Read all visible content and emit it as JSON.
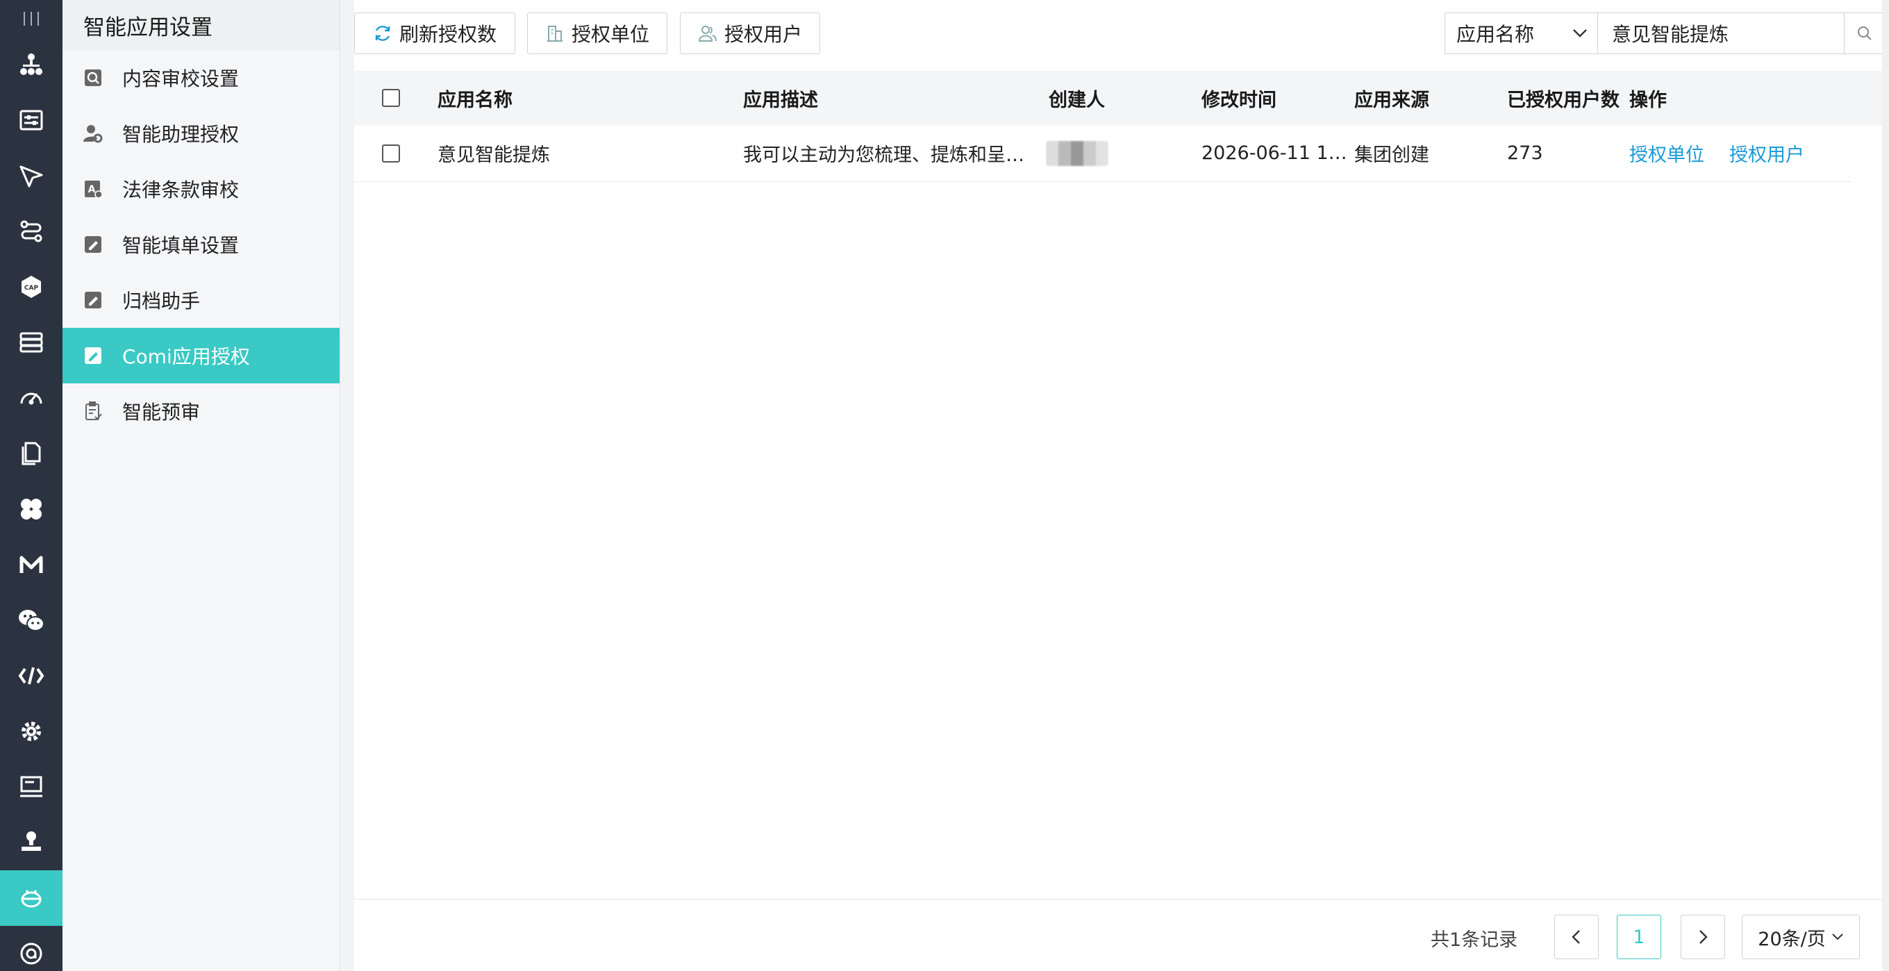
{
  "sidebar": {
    "title": "智能应用设置",
    "items": [
      {
        "label": "内容审校设置",
        "icon": "magnify-doc-icon"
      },
      {
        "label": "智能助理授权",
        "icon": "user-gear-icon"
      },
      {
        "label": "法律条款审校",
        "icon": "law-doc-icon"
      },
      {
        "label": "智能填单设置",
        "icon": "edit-form-icon"
      },
      {
        "label": "归档助手",
        "icon": "archive-edit-icon"
      },
      {
        "label": "Comi应用授权",
        "icon": "edit-form-icon",
        "active": true
      },
      {
        "label": "智能预审",
        "icon": "clipboard-check-icon"
      }
    ]
  },
  "toolbar": {
    "refresh_label": "刷新授权数",
    "auth_unit_label": "授权单位",
    "auth_user_label": "授权用户",
    "search_field": "应用名称",
    "search_value": "意见智能提炼"
  },
  "table": {
    "headers": [
      "应用名称",
      "应用描述",
      "创建人",
      "修改时间",
      "应用来源",
      "已授权用户数",
      "操作"
    ],
    "rows": [
      {
        "name": "意见智能提炼",
        "description": "我可以主动为您梳理、提炼和呈…",
        "creator": "",
        "modified": "2026-06-11 1…",
        "source": "集团创建",
        "authorized_users": "273",
        "action_unit": "授权单位",
        "action_user": "授权用户"
      }
    ]
  },
  "pagination": {
    "total_text": "共1条记录",
    "current_page": "1",
    "page_size": "20条/页"
  },
  "colors": {
    "accent": "#3ac9c4",
    "rail_bg": "#2c3340",
    "link": "#1a9ad6"
  }
}
